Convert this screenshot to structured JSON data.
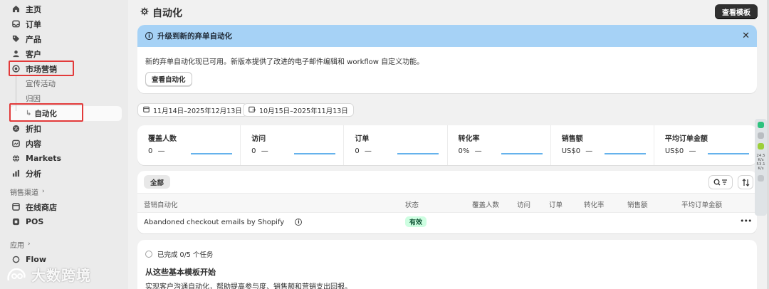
{
  "sidebar": {
    "items": [
      {
        "label": "主页",
        "icon": "home-icon"
      },
      {
        "label": "订单",
        "icon": "inbox-icon"
      },
      {
        "label": "产品",
        "icon": "tag-icon"
      },
      {
        "label": "客户",
        "icon": "person-icon"
      },
      {
        "label": "市场营销",
        "icon": "target-icon"
      }
    ],
    "marketing_sub": [
      {
        "label": "宣传活动"
      },
      {
        "label": "归因"
      },
      {
        "label": "自动化"
      }
    ],
    "items2": [
      {
        "label": "折扣",
        "icon": "discount-icon"
      },
      {
        "label": "内容",
        "icon": "content-icon"
      },
      {
        "label": "Markets",
        "icon": "globe-icon"
      },
      {
        "label": "分析",
        "icon": "chart-icon"
      }
    ],
    "sales_channels_title": "销售渠道",
    "channels": [
      {
        "label": "在线商店",
        "icon": "store-icon"
      },
      {
        "label": "POS",
        "icon": "pos-icon"
      }
    ],
    "apps_title": "应用",
    "apps": [
      {
        "label": "Flow",
        "icon": "flow-icon"
      }
    ]
  },
  "header": {
    "title": "自动化",
    "view_templates": "查看模板"
  },
  "banner": {
    "title": "升级到新的弃单自动化",
    "body": "新的弃单自动化现已可用。新版本提供了改进的电子邮件编辑和 workflow 自定义功能。",
    "button": "查看自动化"
  },
  "dates": {
    "primary": "11月14日–2025年12月13日",
    "compare": "10月15日–2025年11月13日"
  },
  "metrics": [
    {
      "label": "覆盖人数",
      "value": "0",
      "trend": "—"
    },
    {
      "label": "访问",
      "value": "0",
      "trend": "—"
    },
    {
      "label": "订单",
      "value": "0",
      "trend": "—"
    },
    {
      "label": "转化率",
      "value": "0%",
      "trend": "—"
    },
    {
      "label": "销售额",
      "value": "US$0",
      "trend": "—"
    },
    {
      "label": "平均订单金额",
      "value": "US$0",
      "trend": "—"
    }
  ],
  "table": {
    "filter_all": "全部",
    "headers": [
      "营销自动化",
      "状态",
      "覆盖人数",
      "访问",
      "订单",
      "转化率",
      "销售额",
      "平均订单金额"
    ],
    "rows": [
      {
        "name": "Abandoned checkout emails by Shopify",
        "status": "有效"
      }
    ],
    "more": "•••"
  },
  "tasks": {
    "status": "已完成 0/5 个任务",
    "title": "从这些基本模板开始",
    "desc": "实现客户沟通自动化，帮助提高参与度、销售额和营销支出回报。"
  },
  "widget": {
    "lines": [
      "24.5",
      "K/s",
      "53.1",
      "K/s"
    ]
  },
  "watermark": "大数跨境",
  "colors": {
    "banner_bg": "#a6d2f6",
    "highlight": "#e23a3a",
    "badge_bg": "#cdfee1",
    "sparkline": "#65b2ec"
  }
}
